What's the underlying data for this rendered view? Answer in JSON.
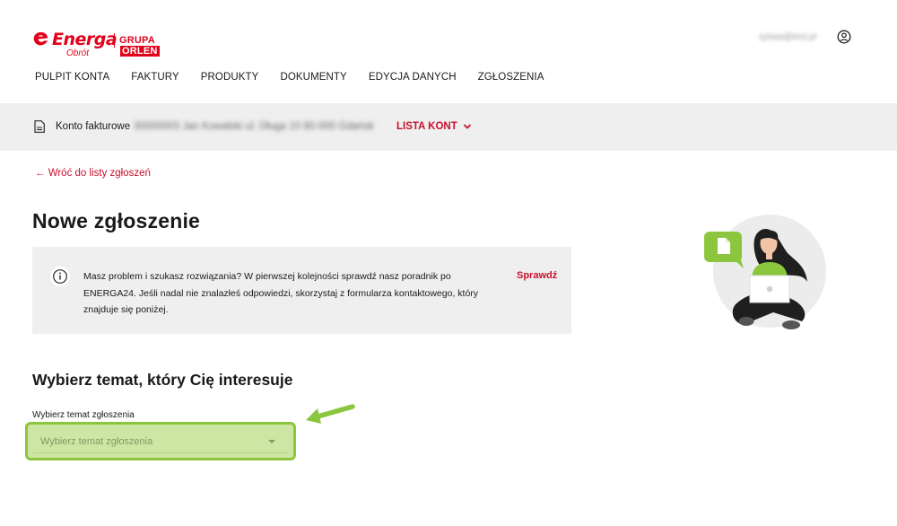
{
  "header": {
    "logo_brand": "Energa",
    "logo_sub": "Obrót",
    "logo_group": "GRUPA",
    "logo_group_brand": "ORLEN",
    "user_email": "sylwia@test.pl"
  },
  "nav": {
    "items": [
      {
        "label": "PULPIT KONTA"
      },
      {
        "label": "FAKTURY"
      },
      {
        "label": "PRODUKTY"
      },
      {
        "label": "DOKUMENTY"
      },
      {
        "label": "EDYCJA DANYCH"
      },
      {
        "label": "ZGŁOSZENIA"
      }
    ]
  },
  "account": {
    "label": "Konto fakturowe",
    "detail": "30000003 Jan Kowalski ul. Długa 10 80-000 Gdańsk",
    "list_link": "LISTA KONT"
  },
  "back_link": "← Wróć do listy zgłoszeń",
  "page_title": "Nowe zgłoszenie",
  "info": {
    "text": "Masz problem i szukasz rozwiązania? W pierwszej kolejności sprawdź nasz poradnik po ENERGA24. Jeśli nadal nie znalazłeś odpowiedzi, skorzystaj z formularza kontaktowego, który znajduje się poniżej.",
    "link": "Sprawdź"
  },
  "topic": {
    "section_title": "Wybierz temat, który Cię interesuje",
    "field_label": "Wybierz temat zgłoszenia",
    "placeholder": "Wybierz temat zgłoszenia"
  },
  "colors": {
    "brand_red": "#e2001a",
    "link_red": "#c8102e",
    "highlight_green": "#8cc63f",
    "panel_grey": "#efefef"
  },
  "icons": {
    "user": "user-circle-icon",
    "document": "document-icon",
    "info": "info-icon",
    "caret": "caret-down-icon",
    "chevron": "chevron-down-icon"
  }
}
